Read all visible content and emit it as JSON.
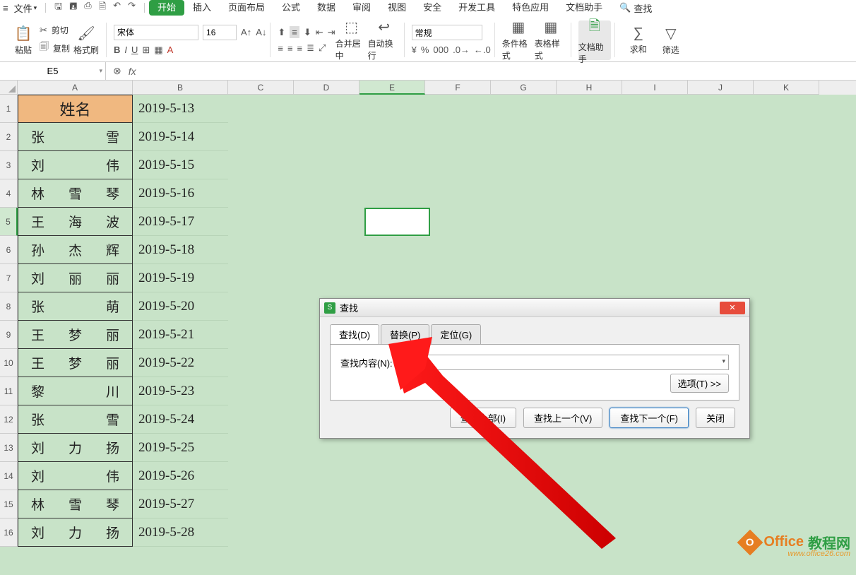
{
  "menubar": {
    "file": "文件",
    "tabs": [
      "开始",
      "插入",
      "页面布局",
      "公式",
      "数据",
      "审阅",
      "视图",
      "安全",
      "开发工具",
      "特色应用",
      "文档助手"
    ],
    "search_label": "查找"
  },
  "ribbon": {
    "paste": "粘贴",
    "cut": "剪切",
    "copy": "复制",
    "format_painter": "格式刷",
    "font_name": "宋体",
    "font_size": "16",
    "merge": "合并居中",
    "wrap": "自动换行",
    "number_format": "常规",
    "cond_fmt": "条件格式",
    "table_fmt": "表格样式",
    "doc_helper": "文档助手",
    "sum": "求和",
    "filter": "筛选"
  },
  "namebox": "E5",
  "columns": [
    "A",
    "B",
    "C",
    "D",
    "E",
    "F",
    "G",
    "H",
    "I",
    "J",
    "K"
  ],
  "header": "姓名",
  "rows": [
    {
      "name": [
        "张",
        "雪"
      ],
      "date": "2019-5-13"
    },
    {
      "name": [
        "刘",
        "伟"
      ],
      "date": "2019-5-14"
    },
    {
      "name": [
        "林",
        "雪",
        "琴"
      ],
      "date": "2019-5-15"
    },
    {
      "name": [
        "王",
        "海",
        "波"
      ],
      "date": "2019-5-16"
    },
    {
      "name": [
        "孙",
        "杰",
        "辉"
      ],
      "date": "2019-5-17"
    },
    {
      "name": [
        "刘",
        "丽",
        "丽"
      ],
      "date": "2019-5-18"
    },
    {
      "name": [
        "张",
        "萌"
      ],
      "date": "2019-5-19"
    },
    {
      "name": [
        "王",
        "梦",
        "丽"
      ],
      "date": "2019-5-20"
    },
    {
      "name": [
        "王",
        "梦",
        "丽"
      ],
      "date": "2019-5-21"
    },
    {
      "name": [
        "黎",
        "川"
      ],
      "date": "2019-5-22"
    },
    {
      "name": [
        "张",
        "雪"
      ],
      "date": "2019-5-23"
    },
    {
      "name": [
        "刘",
        "力",
        "扬"
      ],
      "date": "2019-5-24"
    },
    {
      "name": [
        "刘",
        "伟"
      ],
      "date": "2019-5-25"
    },
    {
      "name": [
        "林",
        "雪",
        "琴"
      ],
      "date": "2019-5-26"
    },
    {
      "name": [
        "刘",
        "力",
        "扬"
      ],
      "date": "2019-5-27"
    }
  ],
  "last_date": "2019-5-28",
  "dialog": {
    "title": "查找",
    "tabs": [
      "查找(D)",
      "替换(P)",
      "定位(G)"
    ],
    "find_label": "查找内容(N):",
    "options": "选项(T) >>",
    "buttons": [
      "查找全部(I)",
      "查找上一个(V)",
      "查找下一个(F)",
      "关闭"
    ]
  },
  "watermark": {
    "brand": "Office",
    "brand2": "教程网",
    "url": "www.office26.com"
  }
}
